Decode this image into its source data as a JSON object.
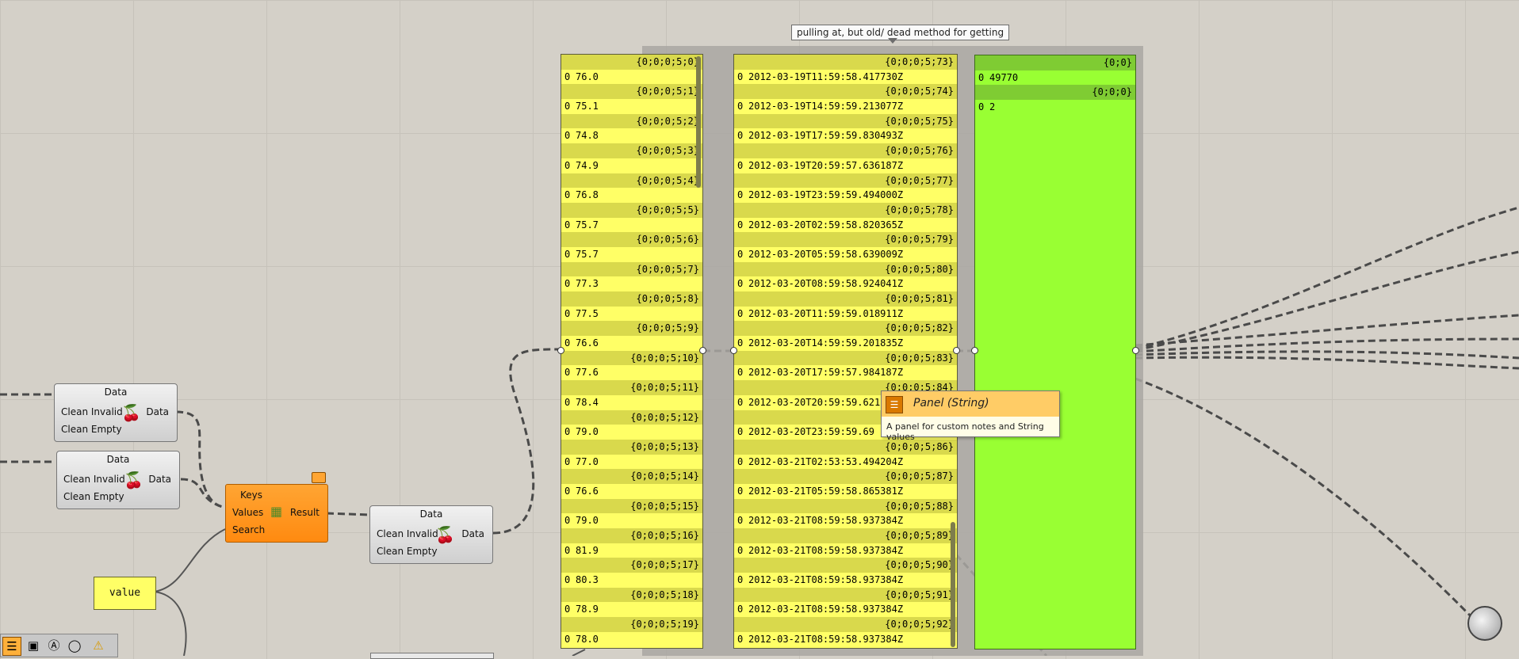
{
  "callout": {
    "text": "pulling at, but old/ dead method for getting"
  },
  "panel_values": {
    "rows": [
      {
        "path": "{0;0;0;5;0}",
        "index": "0",
        "value": "76.0"
      },
      {
        "path": "{0;0;0;5;1}",
        "index": "0",
        "value": "75.1"
      },
      {
        "path": "{0;0;0;5;2}",
        "index": "0",
        "value": "74.8"
      },
      {
        "path": "{0;0;0;5;3}",
        "index": "0",
        "value": "74.9"
      },
      {
        "path": "{0;0;0;5;4}",
        "index": "0",
        "value": "76.8"
      },
      {
        "path": "{0;0;0;5;5}",
        "index": "0",
        "value": "75.7"
      },
      {
        "path": "{0;0;0;5;6}",
        "index": "0",
        "value": "75.7"
      },
      {
        "path": "{0;0;0;5;7}",
        "index": "0",
        "value": "77.3"
      },
      {
        "path": "{0;0;0;5;8}",
        "index": "0",
        "value": "77.5"
      },
      {
        "path": "{0;0;0;5;9}",
        "index": "0",
        "value": "76.6"
      },
      {
        "path": "{0;0;0;5;10}",
        "index": "0",
        "value": "77.6"
      },
      {
        "path": "{0;0;0;5;11}",
        "index": "0",
        "value": "78.4"
      },
      {
        "path": "{0;0;0;5;12}",
        "index": "0",
        "value": "79.0"
      },
      {
        "path": "{0;0;0;5;13}",
        "index": "0",
        "value": "77.0"
      },
      {
        "path": "{0;0;0;5;14}",
        "index": "0",
        "value": "76.6"
      },
      {
        "path": "{0;0;0;5;15}",
        "index": "0",
        "value": "79.0"
      },
      {
        "path": "{0;0;0;5;16}",
        "index": "0",
        "value": "81.9"
      },
      {
        "path": "{0;0;0;5;17}",
        "index": "0",
        "value": "80.3"
      },
      {
        "path": "{0;0;0;5;18}",
        "index": "0",
        "value": "78.9"
      },
      {
        "path": "{0;0;0;5;19}",
        "index": "0",
        "value": "78.0"
      }
    ]
  },
  "panel_dates": {
    "rows": [
      {
        "path": "{0;0;0;5;73}",
        "index": "0",
        "value": "2012-03-19T11:59:58.417730Z"
      },
      {
        "path": "{0;0;0;5;74}",
        "index": "0",
        "value": "2012-03-19T14:59:59.213077Z"
      },
      {
        "path": "{0;0;0;5;75}",
        "index": "0",
        "value": "2012-03-19T17:59:59.830493Z"
      },
      {
        "path": "{0;0;0;5;76}",
        "index": "0",
        "value": "2012-03-19T20:59:57.636187Z"
      },
      {
        "path": "{0;0;0;5;77}",
        "index": "0",
        "value": "2012-03-19T23:59:59.494000Z"
      },
      {
        "path": "{0;0;0;5;78}",
        "index": "0",
        "value": "2012-03-20T02:59:58.820365Z"
      },
      {
        "path": "{0;0;0;5;79}",
        "index": "0",
        "value": "2012-03-20T05:59:58.639009Z"
      },
      {
        "path": "{0;0;0;5;80}",
        "index": "0",
        "value": "2012-03-20T08:59:58.924041Z"
      },
      {
        "path": "{0;0;0;5;81}",
        "index": "0",
        "value": "2012-03-20T11:59:59.018911Z"
      },
      {
        "path": "{0;0;0;5;82}",
        "index": "0",
        "value": "2012-03-20T14:59:59.201835Z"
      },
      {
        "path": "{0;0;0;5;83}",
        "index": "0",
        "value": "2012-03-20T17:59:57.984187Z"
      },
      {
        "path": "{0;0;0;5;84}",
        "index": "0",
        "value": "2012-03-20T20:59:59.621"
      },
      {
        "path": "{0;0;0;5;85}",
        "index": "0",
        "value": "2012-03-20T23:59:59.69"
      },
      {
        "path": "{0;0;0;5;86}",
        "index": "0",
        "value": "2012-03-21T02:53:53.494204Z"
      },
      {
        "path": "{0;0;0;5;87}",
        "index": "0",
        "value": "2012-03-21T05:59:58.865381Z"
      },
      {
        "path": "{0;0;0;5;88}",
        "index": "0",
        "value": "2012-03-21T08:59:58.937384Z"
      },
      {
        "path": "{0;0;0;5;89}",
        "index": "0",
        "value": "2012-03-21T08:59:58.937384Z"
      },
      {
        "path": "{0;0;0;5;90}",
        "index": "0",
        "value": "2012-03-21T08:59:58.937384Z"
      },
      {
        "path": "{0;0;0;5;91}",
        "index": "0",
        "value": "2012-03-21T08:59:58.937384Z"
      },
      {
        "path": "{0;0;0;5;92}",
        "index": "0",
        "value": "2012-03-21T08:59:58.937384Z"
      }
    ]
  },
  "panel_green": {
    "rows": [
      {
        "path": "{0;0}",
        "index": "0",
        "value": "49770"
      },
      {
        "path": "{0;0;0}",
        "index": "0",
        "value": "2"
      }
    ]
  },
  "clean1": {
    "title": "Data",
    "in1": "Clean Invalid",
    "in2": "Clean Empty",
    "out": "Data"
  },
  "clean2": {
    "title": "Data",
    "in1": "Clean Invalid",
    "in2": "Clean Empty",
    "out": "Data"
  },
  "clean3": {
    "title": "Data",
    "in1": "Clean Invalid",
    "in2": "Clean Empty",
    "out": "Data"
  },
  "dict": {
    "keys": "Keys",
    "values": "Values",
    "search": "Search",
    "result": "Result"
  },
  "value_node": {
    "label": "value"
  },
  "tooltip": {
    "title": "Panel (String)",
    "description": "A panel for custom notes and String values"
  },
  "taskbar": {
    "icons": [
      "grasshopper-icon",
      "component-icon",
      "text-icon",
      "database-icon",
      "warning-icon"
    ]
  },
  "colors": {
    "panel_yellow": "#ffff66",
    "panel_green": "#99ff33",
    "component_orange": "#ff8a10",
    "canvas": "#d4d0c8"
  }
}
